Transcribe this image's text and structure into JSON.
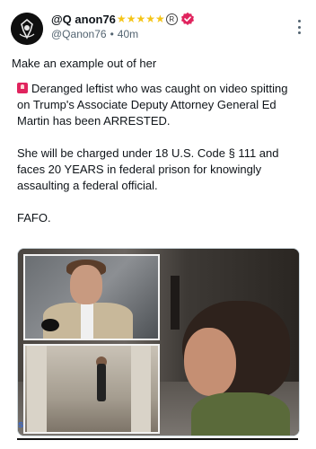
{
  "user": {
    "display_name": "@Q anon76",
    "handle": "@Qanon76",
    "time": "40m",
    "badges": [
      "star",
      "star",
      "star",
      "star",
      "star",
      "registered",
      "verified-check"
    ]
  },
  "caption": "Make an example out of her",
  "tweet": {
    "emoji": "siren-icon",
    "paragraph1": "Deranged leftist who was caught on video spitting on Trump's Associate Deputy Attorney General Ed Martin has been ARRESTED.",
    "paragraph2": "She will be charged under 18 U.S. Code § 111 and faces 20 YEARS in federal prison for knowingly assaulting a federal official.",
    "paragraph3": "FAFO."
  },
  "media": {
    "overlay_letter": "s"
  },
  "colors": {
    "star": "#f5c518",
    "verified": "#e0245e",
    "secondary_text": "#536471"
  }
}
